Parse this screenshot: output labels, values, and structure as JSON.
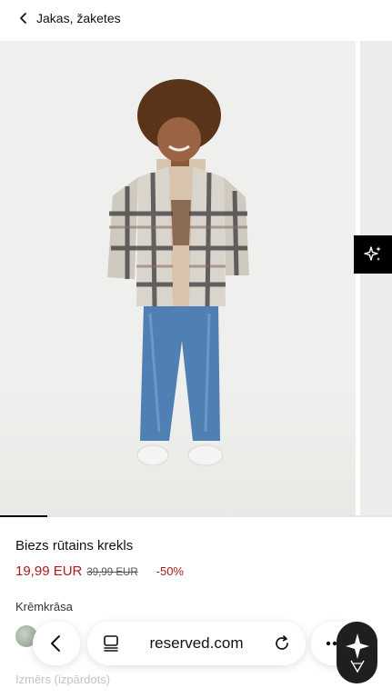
{
  "header": {
    "back_label": "Jakas, žaketes"
  },
  "gallery": {
    "progress_fraction": 0.12,
    "ai_button_icon": "sparkles-icon"
  },
  "product": {
    "name": "Biezs rūtains krekls",
    "price_current": "19,99 EUR",
    "price_old": "39,99 EUR",
    "discount": "-50%",
    "color_label": "Krēmkrāsa",
    "size_label": "Izmērs (izpārdots)"
  },
  "browser": {
    "url": "reserved.com"
  },
  "colors": {
    "sale_red": "#b01a1a",
    "accent_black": "#000000"
  }
}
